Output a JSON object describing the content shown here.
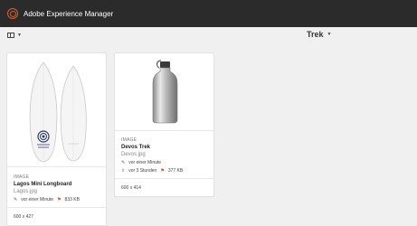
{
  "header": {
    "app_title": "Adobe Experience Manager"
  },
  "toolbar": {
    "folder_title": "Trek",
    "caret": "⌄"
  },
  "cards": [
    {
      "type": "IMAGE",
      "title": "Lagos Mini Longboard",
      "filename": "Lagos.jpg",
      "modified": "vor einer Minute",
      "size": "833 KB",
      "dimensions": "600 x 427"
    },
    {
      "type": "IMAGE",
      "title": "Devos Trek",
      "filename": "Devos.jpg",
      "modified": "vor einer Minute",
      "published": "vor 3 Stunden",
      "size": "377 KB",
      "dimensions": "600 x 414"
    }
  ]
}
